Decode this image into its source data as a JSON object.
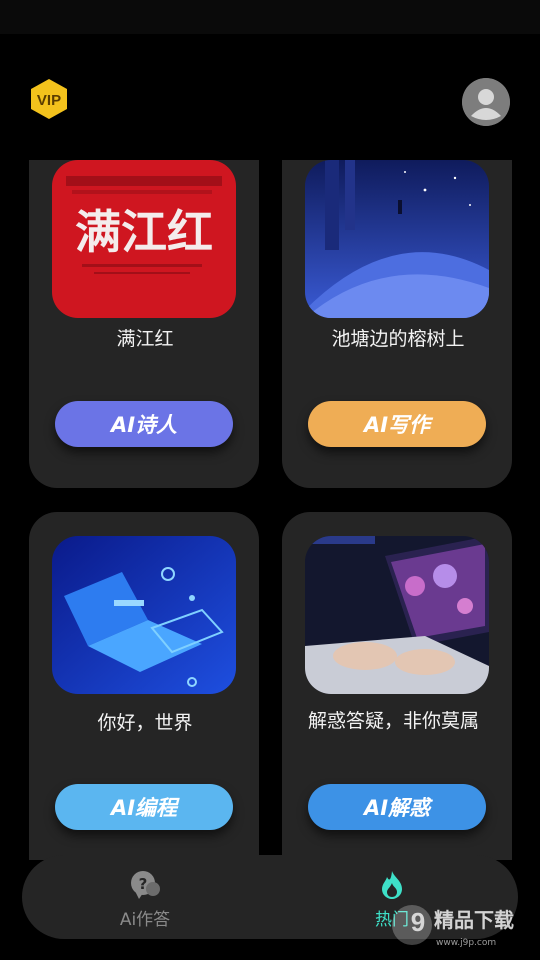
{
  "header": {
    "vip_label": "VIP"
  },
  "cards": [
    {
      "title": "满江红",
      "thumb_text": "满江红",
      "button_label": "AI诗人"
    },
    {
      "title": "池塘边的榕树上",
      "button_label": "AI写作"
    },
    {
      "title": "你好，世界",
      "button_label": "AI编程"
    },
    {
      "title": "解惑答疑，非你莫属",
      "button_label": "AI解惑"
    }
  ],
  "tabs": [
    {
      "label": "Ai作答",
      "icon": "question-chat-icon",
      "color": "#8a8a8a"
    },
    {
      "label": "热门",
      "icon": "flame-icon",
      "color": "#3ee0c8"
    }
  ],
  "watermark": {
    "text": "精品下载",
    "sub": "www.j9p.com"
  },
  "colors": {
    "background": "#000000",
    "card": "#252525",
    "pill_poet": "#6b74e6",
    "pill_write": "#efad55",
    "pill_code": "#5bb6f0",
    "pill_answer": "#3d92e6",
    "accent": "#3ee0c8"
  }
}
